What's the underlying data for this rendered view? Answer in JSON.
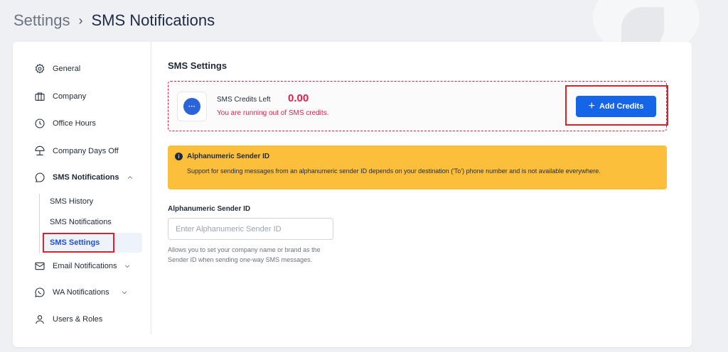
{
  "breadcrumb": {
    "root": "Settings",
    "separator": "›",
    "current": "SMS Notifications"
  },
  "sidebar": {
    "items": [
      {
        "label": "General",
        "icon": "gear-icon"
      },
      {
        "label": "Company",
        "icon": "briefcase-icon"
      },
      {
        "label": "Office Hours",
        "icon": "clock-icon"
      },
      {
        "label": "Company Days Off",
        "icon": "beach-umbrella-icon"
      },
      {
        "label": "SMS Notifications",
        "icon": "message-icon",
        "expanded": true
      },
      {
        "label": "Email Notifications",
        "icon": "mail-icon"
      },
      {
        "label": "WA Notifications",
        "icon": "whatsapp-icon"
      },
      {
        "label": "Users & Roles",
        "icon": "user-icon"
      }
    ],
    "sms_sub_items": [
      {
        "label": "SMS History"
      },
      {
        "label": "SMS Notifications"
      },
      {
        "label": "SMS Settings",
        "active": true
      }
    ]
  },
  "main": {
    "section_title": "SMS Settings",
    "credits": {
      "label": "SMS Credits Left",
      "value": "0.00",
      "warning": "You are running out of SMS credits.",
      "add_button": "Add Credits",
      "icon_text": "···"
    },
    "info": {
      "title": "Alphanumeric Sender ID",
      "text": "Support for sending messages from an alphanumeric sender ID depends on your destination ('To') phone number and is not available everywhere.",
      "icon_text": "i"
    },
    "sender_field": {
      "label": "Alphanumeric Sender ID",
      "placeholder": "Enter Alphanumeric Sender ID",
      "value": "",
      "help": "Allows you to set your company name or brand as the Sender ID when sending one-way SMS messages."
    }
  },
  "colors": {
    "accent": "#1565e8",
    "danger": "#e11d48",
    "warning_bg": "#fbbf3c",
    "highlight_box": "#e0212c"
  }
}
